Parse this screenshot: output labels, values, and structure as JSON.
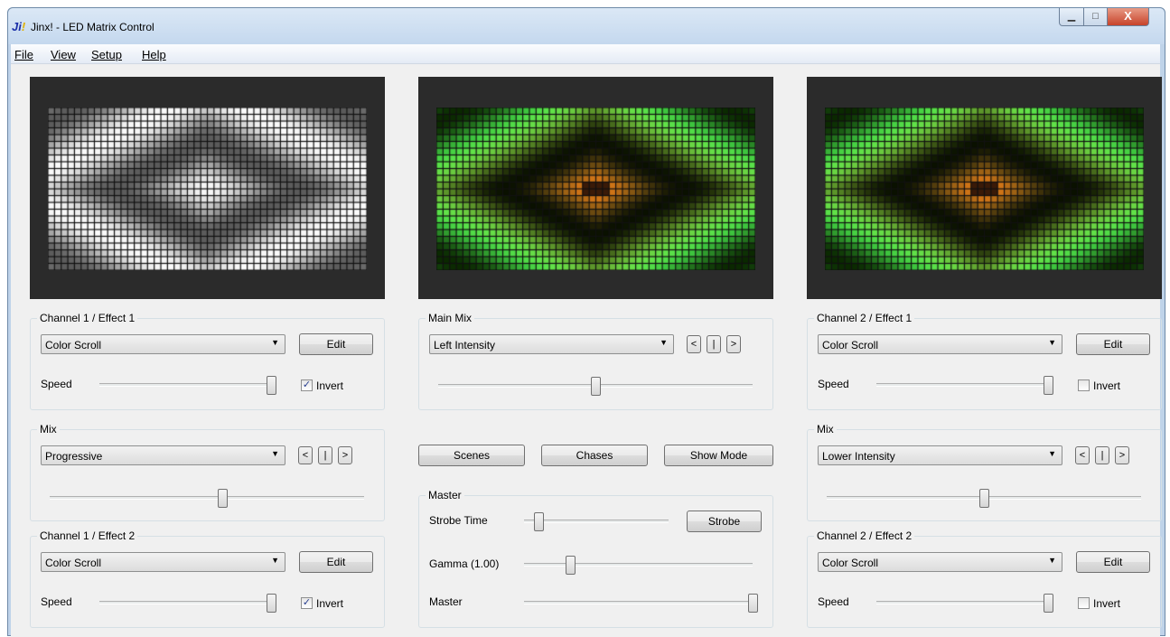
{
  "window": {
    "title": "Jinx! - LED Matrix Control",
    "logo": {
      "main": "Ji",
      "bang": "!"
    },
    "controls": {
      "minimize": "▁",
      "maximize": "□",
      "close": "X"
    }
  },
  "menu": [
    "File",
    "View",
    "Setup",
    "Help"
  ],
  "left": {
    "effect1": {
      "title": "Channel 1 / Effect 1",
      "effect": "Color Scroll",
      "edit_label": "Edit",
      "speed_label": "Speed",
      "speed_value": 1.0,
      "invert_label": "Invert",
      "invert": true
    },
    "mix": {
      "title": "Mix",
      "mode": "Progressive",
      "prev": "<",
      "mid": "|",
      "next": ">",
      "value": 0.55
    },
    "effect2": {
      "title": "Channel 1 / Effect 2",
      "effect": "Color Scroll",
      "edit_label": "Edit",
      "speed_label": "Speed",
      "speed_value": 1.0,
      "invert_label": "Invert",
      "invert": true
    }
  },
  "center": {
    "main_mix": {
      "title": "Main Mix",
      "mode": "Left Intensity",
      "prev": "<",
      "mid": "|",
      "next": ">",
      "value": 0.5
    },
    "buttons": {
      "scenes": "Scenes",
      "chases": "Chases",
      "show_mode": "Show Mode"
    },
    "master": {
      "title": "Master",
      "strobe_label": "Strobe Time",
      "strobe_value": 0.1,
      "strobe_button": "Strobe",
      "gamma_label": "Gamma (1.00)",
      "gamma_value": 0.2,
      "master_label": "Master",
      "master_value": 1.0
    }
  },
  "right": {
    "effect1": {
      "title": "Channel 2 / Effect 1",
      "effect": "Color Scroll",
      "edit_label": "Edit",
      "speed_label": "Speed",
      "speed_value": 1.0,
      "invert_label": "Invert",
      "invert": false
    },
    "mix": {
      "title": "Mix",
      "mode": "Lower Intensity",
      "prev": "<",
      "mid": "|",
      "next": ">",
      "value": 0.5
    },
    "effect2": {
      "title": "Channel 2 / Effect 2",
      "effect": "Color Scroll",
      "edit_label": "Edit",
      "speed_label": "Speed",
      "speed_value": 1.0,
      "invert_label": "Invert",
      "invert": false
    }
  },
  "previews": {
    "left": {
      "palette": "grayscale"
    },
    "center": {
      "palette": "green-yellow-orange"
    },
    "right": {
      "palette": "green-yellow-orange"
    }
  }
}
